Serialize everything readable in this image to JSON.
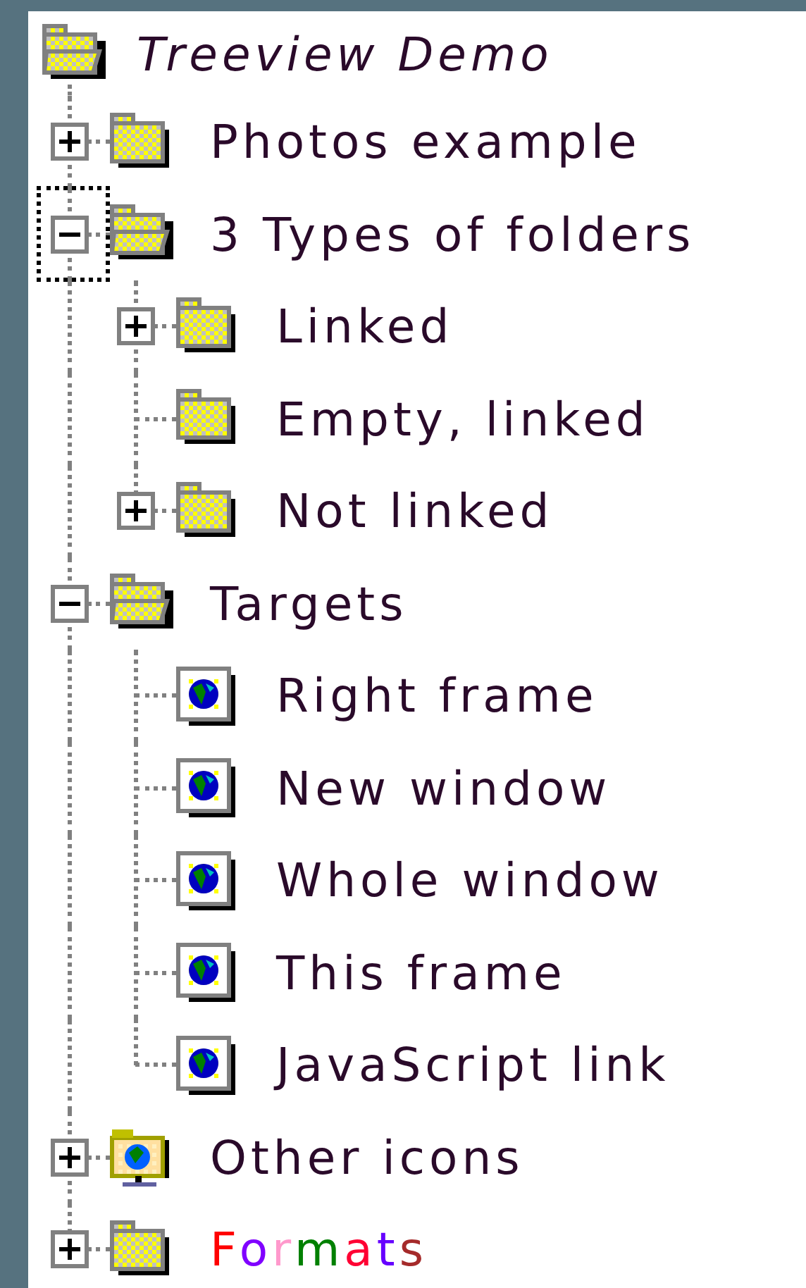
{
  "tree": {
    "label": "Treeview Demo",
    "kind": "open-folder",
    "multicolor": false,
    "children": [
      {
        "label": "Photos example",
        "kind": "folder",
        "expanded": false,
        "focused": false,
        "multicolor": false
      },
      {
        "label": "3 Types of folders",
        "kind": "open-folder",
        "expanded": true,
        "focused": true,
        "multicolor": false,
        "children": [
          {
            "label": "Linked",
            "kind": "folder",
            "expanded": false,
            "focused": false,
            "multicolor": false
          },
          {
            "label": "Empty, linked",
            "kind": "folder",
            "focused": false,
            "multicolor": false
          },
          {
            "label": "Not linked",
            "kind": "folder",
            "expanded": false,
            "focused": false,
            "multicolor": false
          }
        ]
      },
      {
        "label": "Targets",
        "kind": "open-folder",
        "expanded": true,
        "focused": false,
        "multicolor": false,
        "children": [
          {
            "label": "Right frame",
            "kind": "page",
            "focused": false,
            "multicolor": false
          },
          {
            "label": "New window",
            "kind": "page",
            "focused": false,
            "multicolor": false
          },
          {
            "label": "Whole window",
            "kind": "page",
            "focused": false,
            "multicolor": false
          },
          {
            "label": "This frame",
            "kind": "page",
            "focused": false,
            "multicolor": false
          },
          {
            "label": "JavaScript link",
            "kind": "page",
            "focused": false,
            "multicolor": false
          }
        ]
      },
      {
        "label": "Other icons",
        "kind": "monitor",
        "expanded": false,
        "focused": false,
        "multicolor": false
      },
      {
        "label": "Formats",
        "kind": "folder",
        "expanded": false,
        "focused": false,
        "multicolor": true
      }
    ]
  }
}
